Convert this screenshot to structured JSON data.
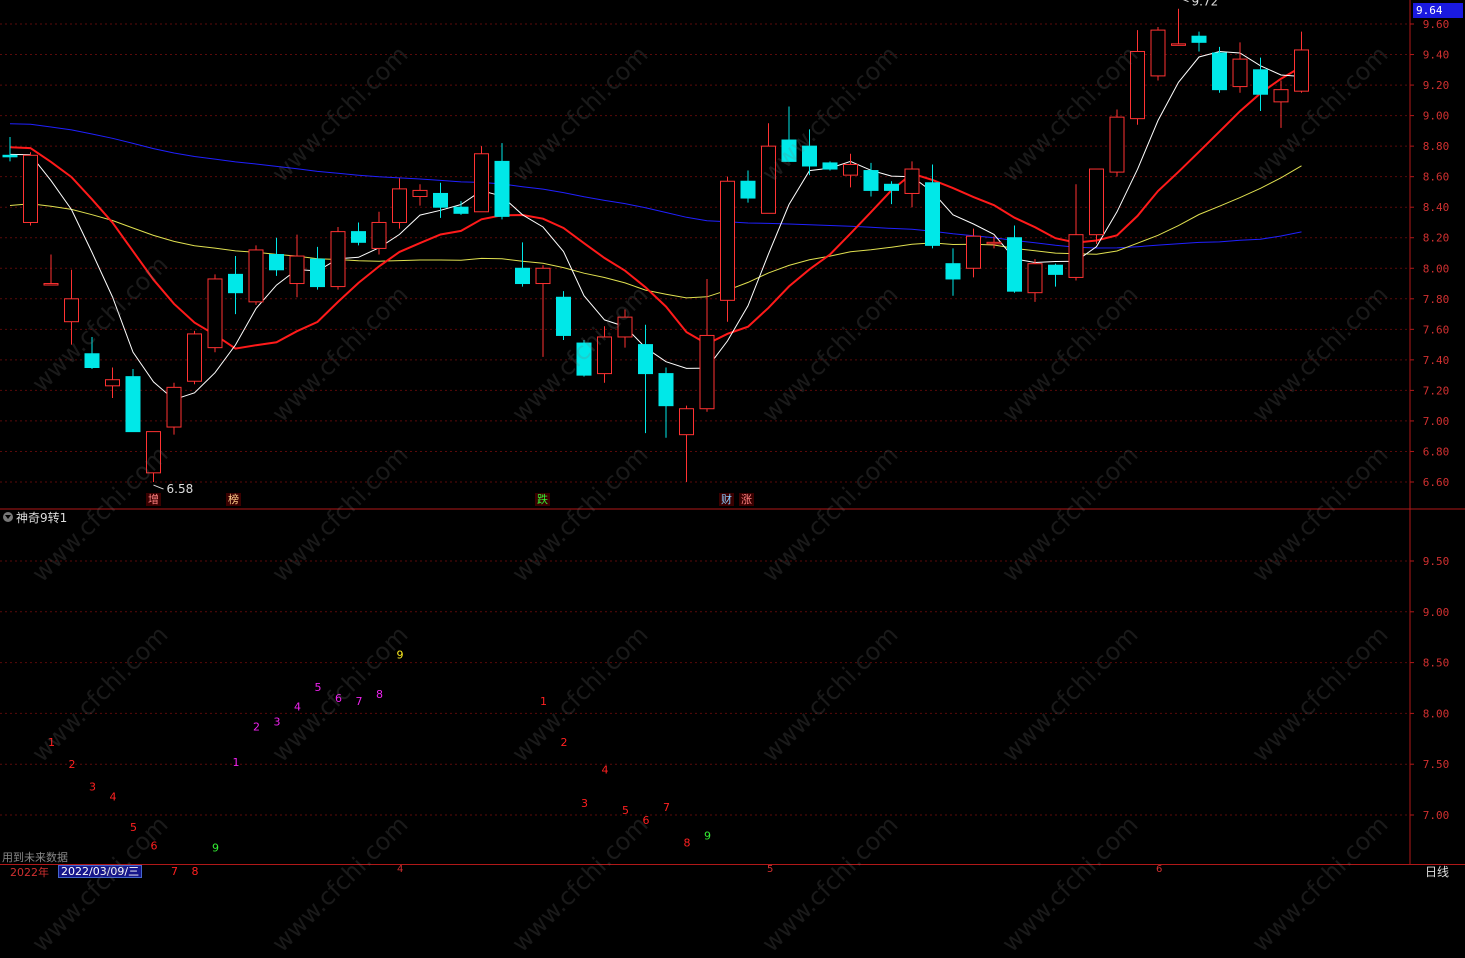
{
  "current_price_box": "9.64",
  "indicator": {
    "title": "神奇9转1"
  },
  "future_note": "用到未来数据",
  "bottom_bar": {
    "year": "2022年",
    "date": "2022/03/09/三",
    "months": [
      "4",
      "5",
      "6"
    ],
    "period": "日线"
  },
  "event_tags": [
    {
      "text": "增",
      "color": "#ff8080"
    },
    {
      "text": "榜",
      "color": "#ffcc88"
    },
    {
      "text": "跌",
      "color": "#33ee33"
    },
    {
      "text": "财",
      "color": "#88ccff"
    },
    {
      "text": "涨",
      "color": "#ff8080"
    }
  ],
  "watermark_text": "www.cfchi.com",
  "chart_data": [
    {
      "type": "candlestick",
      "y_ticks": [
        "9.60",
        "9.40",
        "9.20",
        "9.00",
        "8.80",
        "8.60",
        "8.40",
        "8.20",
        "8.00",
        "7.80",
        "7.60",
        "7.40",
        "7.20",
        "7.00",
        "6.80",
        "6.60"
      ],
      "ylim": [
        6.55,
        9.75
      ],
      "annotations": [
        {
          "text": "9.72",
          "value": 9.72,
          "index": 57
        },
        {
          "text": "6.58",
          "value": 6.58,
          "index": 7
        }
      ],
      "colors": {
        "up": "#ff3232",
        "down": "#00e8e8",
        "ma5": "#ffffff",
        "ma10": "#ff1a1a",
        "ma30": "#e0e050",
        "ma60": "#2020ff"
      },
      "candles": [
        [
          8.74,
          8.73,
          8.86,
          8.7
        ],
        [
          8.3,
          8.74,
          8.76,
          8.28
        ],
        [
          7.9,
          7.9,
          8.09,
          7.89
        ],
        [
          7.65,
          7.8,
          7.99,
          7.5
        ],
        [
          7.44,
          7.35,
          7.55,
          7.34
        ],
        [
          7.23,
          7.27,
          7.35,
          7.15
        ],
        [
          7.29,
          6.93,
          7.34,
          6.93
        ],
        [
          6.66,
          6.93,
          6.74,
          6.6
        ],
        [
          6.96,
          7.22,
          7.25,
          6.91
        ],
        [
          7.26,
          7.57,
          7.59,
          7.24
        ],
        [
          7.48,
          7.93,
          7.96,
          7.45
        ],
        [
          7.96,
          7.84,
          8.08,
          7.7
        ],
        [
          7.78,
          8.12,
          8.15,
          7.76
        ],
        [
          8.09,
          7.99,
          8.2,
          7.95
        ],
        [
          7.9,
          8.08,
          8.22,
          7.81
        ],
        [
          8.06,
          7.88,
          8.14,
          7.86
        ],
        [
          7.88,
          8.24,
          8.27,
          7.86
        ],
        [
          8.24,
          8.17,
          8.3,
          8.15
        ],
        [
          8.13,
          8.3,
          8.37,
          8.09
        ],
        [
          8.3,
          8.52,
          8.59,
          8.26
        ],
        [
          8.47,
          8.51,
          8.55,
          8.41
        ],
        [
          8.49,
          8.4,
          8.56,
          8.33
        ],
        [
          8.4,
          8.36,
          8.44,
          8.35
        ],
        [
          8.37,
          8.75,
          8.8,
          8.38
        ],
        [
          8.7,
          8.34,
          8.82,
          8.32
        ],
        [
          8.0,
          7.9,
          8.17,
          7.88
        ],
        [
          7.9,
          8.0,
          8.02,
          7.42
        ],
        [
          7.81,
          7.56,
          7.85,
          7.53
        ],
        [
          7.51,
          7.3,
          7.53,
          7.29
        ],
        [
          7.31,
          7.55,
          7.62,
          7.25
        ],
        [
          7.55,
          7.68,
          7.73,
          7.48
        ],
        [
          7.5,
          7.31,
          7.63,
          6.92
        ],
        [
          7.31,
          7.1,
          7.35,
          6.89
        ],
        [
          6.91,
          7.08,
          7.1,
          6.6
        ],
        [
          7.08,
          7.56,
          7.93,
          7.06
        ],
        [
          7.79,
          8.57,
          8.6,
          7.65
        ],
        [
          8.57,
          8.46,
          8.64,
          8.43
        ],
        [
          8.36,
          8.8,
          8.95,
          8.37
        ],
        [
          8.84,
          8.7,
          9.06,
          8.71
        ],
        [
          8.8,
          8.67,
          8.91,
          8.61
        ],
        [
          8.69,
          8.65,
          8.7,
          8.64
        ],
        [
          8.61,
          8.68,
          8.75,
          8.53
        ],
        [
          8.64,
          8.51,
          8.69,
          8.47
        ],
        [
          8.55,
          8.51,
          8.57,
          8.42
        ],
        [
          8.49,
          8.65,
          8.7,
          8.4
        ],
        [
          8.56,
          8.15,
          8.68,
          8.13
        ],
        [
          8.03,
          7.93,
          8.13,
          7.82
        ],
        [
          8.0,
          8.21,
          8.26,
          7.94
        ],
        [
          8.16,
          8.17,
          8.21,
          8.13
        ],
        [
          8.2,
          7.85,
          8.28,
          7.84
        ],
        [
          7.84,
          8.03,
          8.06,
          7.78
        ],
        [
          8.02,
          7.96,
          8.03,
          7.88
        ],
        [
          7.94,
          8.22,
          8.55,
          7.92
        ],
        [
          8.22,
          8.65,
          8.65,
          8.16
        ],
        [
          8.63,
          8.99,
          9.04,
          8.6
        ],
        [
          8.98,
          9.42,
          9.56,
          8.94
        ],
        [
          9.26,
          9.56,
          9.58,
          9.23
        ],
        [
          9.47,
          9.47,
          9.7,
          9.46
        ],
        [
          9.52,
          9.48,
          9.55,
          9.42
        ],
        [
          9.41,
          9.17,
          9.45,
          9.15
        ],
        [
          9.19,
          9.37,
          9.48,
          9.15
        ],
        [
          9.3,
          9.14,
          9.38,
          9.03
        ],
        [
          9.09,
          9.17,
          9.23,
          8.92
        ],
        [
          9.16,
          9.43,
          9.55,
          9.15
        ]
      ]
    },
    {
      "type": "sequence_count",
      "title": "神奇9转1",
      "y_ticks": [
        "9.50",
        "9.00",
        "8.50",
        "8.00",
        "7.50",
        "7.00"
      ],
      "points": [
        {
          "label": "1",
          "index": 1,
          "y": 7.72,
          "color": "#ff2020"
        },
        {
          "label": "2",
          "index": 2,
          "y": 7.5,
          "color": "#ff2020"
        },
        {
          "label": "3",
          "index": 3,
          "y": 7.28,
          "color": "#ff2020"
        },
        {
          "label": "4",
          "index": 4,
          "y": 7.18,
          "color": "#ff2020"
        },
        {
          "label": "5",
          "index": 5,
          "y": 6.88,
          "color": "#ff2020"
        },
        {
          "label": "6",
          "index": 6,
          "y": 6.7,
          "color": "#ff2020"
        },
        {
          "label": "7",
          "index": 7,
          "y": 6.45,
          "color": "#ff2020"
        },
        {
          "label": "8",
          "index": 8,
          "y": 6.45,
          "color": "#ff2020"
        },
        {
          "label": "9",
          "index": 9,
          "y": 6.68,
          "color": "#33ee33"
        },
        {
          "label": "1",
          "index": 10,
          "y": 7.52,
          "color": "#ee22ee"
        },
        {
          "label": "2",
          "index": 11,
          "y": 7.87,
          "color": "#ee22ee"
        },
        {
          "label": "3",
          "index": 12,
          "y": 7.92,
          "color": "#ee22ee"
        },
        {
          "label": "4",
          "index": 13,
          "y": 8.07,
          "color": "#ee22ee"
        },
        {
          "label": "5",
          "index": 14,
          "y": 8.26,
          "color": "#ee22ee"
        },
        {
          "label": "6",
          "index": 15,
          "y": 8.15,
          "color": "#ee22ee"
        },
        {
          "label": "7",
          "index": 16,
          "y": 8.12,
          "color": "#ee22ee"
        },
        {
          "label": "8",
          "index": 17,
          "y": 8.19,
          "color": "#ee22ee"
        },
        {
          "label": "9",
          "index": 18,
          "y": 8.58,
          "color": "#ffee20"
        },
        {
          "label": "1",
          "index": 25,
          "y": 8.12,
          "color": "#ff2020"
        },
        {
          "label": "2",
          "index": 26,
          "y": 7.72,
          "color": "#ff2020"
        },
        {
          "label": "3",
          "index": 27,
          "y": 7.12,
          "color": "#ff2020"
        },
        {
          "label": "4",
          "index": 28,
          "y": 7.45,
          "color": "#ff2020"
        },
        {
          "label": "5",
          "index": 29,
          "y": 7.05,
          "color": "#ff2020"
        },
        {
          "label": "6",
          "index": 30,
          "y": 6.95,
          "color": "#ff2020"
        },
        {
          "label": "7",
          "index": 31,
          "y": 7.08,
          "color": "#ff2020"
        },
        {
          "label": "8",
          "index": 32,
          "y": 6.73,
          "color": "#ff2020"
        },
        {
          "label": "9",
          "index": 33,
          "y": 6.8,
          "color": "#33ee33"
        }
      ]
    }
  ]
}
